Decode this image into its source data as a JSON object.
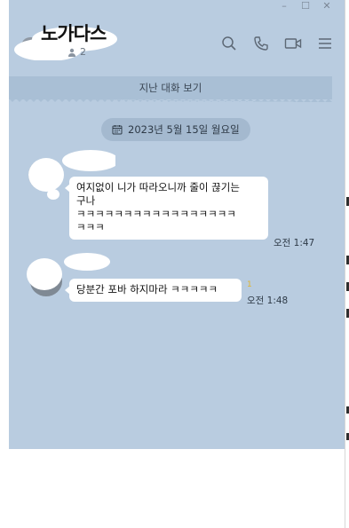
{
  "window": {
    "controls": {
      "minimize": "–",
      "maximize": "☐",
      "close": "✕"
    }
  },
  "header": {
    "title": "노가다스",
    "member_count": "2",
    "icons": [
      "search-icon",
      "phone-icon",
      "video-call-icon",
      "menu-icon"
    ]
  },
  "old_chat_banner": "지난 대화 보기",
  "date_divider": "2023년 5월 15일 월요일",
  "messages": [
    {
      "lines": [
        "여지없이 니가 따라오니까 줄이 끊기는",
        "구나",
        "ㅋㅋㅋㅋㅋㅋㅋㅋㅋㅋㅋㅋㅋㅋㅋㅋㅋ",
        "ㅋㅋㅋ"
      ],
      "time": "오전 1:47"
    },
    {
      "lines": [
        "당분간 포바 하지마라 ㅋㅋㅋㅋㅋ"
      ],
      "time": "오전 1:48",
      "unread": "1"
    }
  ],
  "colors": {
    "chat_bg": "#b9cce0",
    "bubble": "#ffffff",
    "banner": "#a9bfd5"
  }
}
